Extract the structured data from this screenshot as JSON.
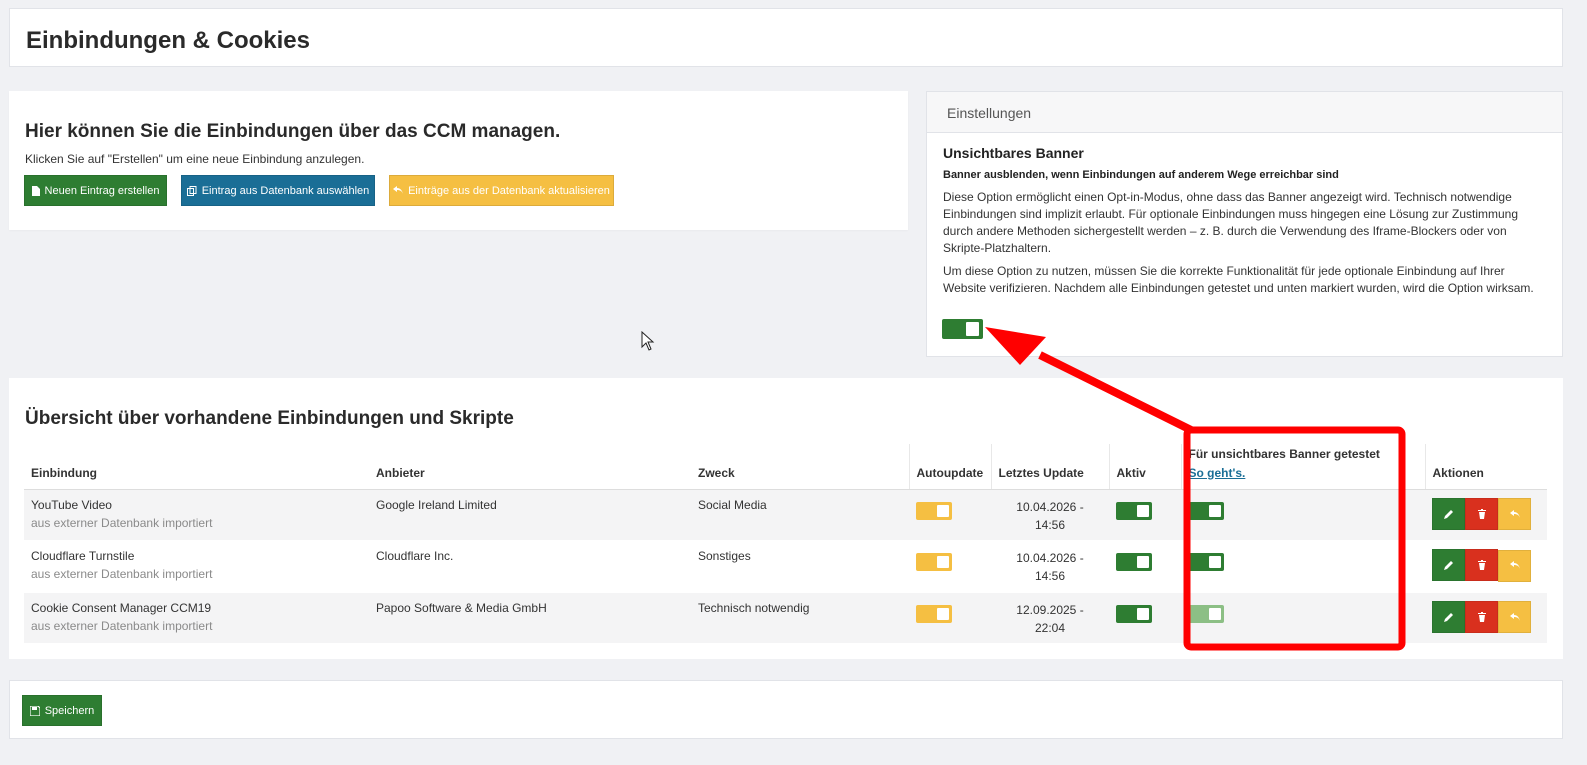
{
  "page_title": "Einbindungen & Cookies",
  "manage": {
    "heading": "Hier können Sie die Einbindungen über das CCM managen.",
    "hint": "Klicken Sie auf \"Erstellen\" um eine neue Einbindung anzulegen.",
    "buttons": {
      "create": "Neuen Eintrag erstellen",
      "select_db": "Eintrag aus Datenbank auswählen",
      "update_db": "Einträge aus der Datenbank aktualisieren"
    }
  },
  "settings": {
    "header": "Einstellungen",
    "subheading": "Unsichtbares Banner",
    "option_label": "Banner ausblenden, wenn Einbindungen auf anderem Wege erreichbar sind",
    "para1": "Diese Option ermöglicht einen Opt-in-Modus, ohne dass das Banner angezeigt wird. Technisch notwendige Einbindungen sind implizit erlaubt. Für optionale Einbindungen muss hingegen eine Lösung zur Zustimmung durch andere Methoden sichergestellt werden – z. B. durch die Verwendung des Iframe-Blockers oder von Skripte-Platzhaltern.",
    "para2": "Um diese Option zu nutzen, müssen Sie die korrekte Funktionalität für jede optionale Einbindung auf Ihrer Website verifizieren. Nachdem alle Einbindungen getestet und unten markiert wurden, wird die Option wirksam.",
    "invisible_banner_enabled": true
  },
  "overview": {
    "heading": "Übersicht über vorhandene Einbindungen und Skripte",
    "columns": {
      "embedding": "Einbindung",
      "provider": "Anbieter",
      "purpose": "Zweck",
      "autoupdate": "Autoupdate",
      "last_update": "Letztes Update",
      "active": "Aktiv",
      "tested": "Für unsichtbares Banner getestet",
      "tested_link": "So geht's.",
      "actions": "Aktionen"
    },
    "rows": [
      {
        "name": "YouTube Video",
        "source": "aus externer Datenbank importiert",
        "provider": "Google Ireland Limited",
        "purpose": "Social Media",
        "autoupdate": true,
        "date": "10.04.2026 -",
        "time": "14:56",
        "active": true,
        "tested": true,
        "tested_disabled": false
      },
      {
        "name": "Cloudflare Turnstile",
        "source": "aus externer Datenbank importiert",
        "provider": "Cloudflare Inc.",
        "purpose": "Sonstiges",
        "autoupdate": true,
        "date": "10.04.2026 -",
        "time": "14:56",
        "active": true,
        "tested": true,
        "tested_disabled": false
      },
      {
        "name": "Cookie Consent Manager CCM19",
        "source": "aus externer Datenbank importiert",
        "provider": "Papoo Software & Media GmbH",
        "purpose": "Technisch notwendig",
        "autoupdate": true,
        "date": "12.09.2025 -",
        "time": "22:04",
        "active": true,
        "tested": true,
        "tested_disabled": true
      }
    ]
  },
  "save_label": "Speichern",
  "colors": {
    "green": "#2e7d32",
    "blue": "#1a6e96",
    "yellow": "#f5bf42",
    "red": "#d9301e",
    "annotation_red": "#ff0000"
  },
  "icons": [
    "file-icon",
    "copy-icon",
    "undo-icon",
    "pencil-icon",
    "trash-icon",
    "save-icon",
    "mouse-cursor-icon"
  ]
}
